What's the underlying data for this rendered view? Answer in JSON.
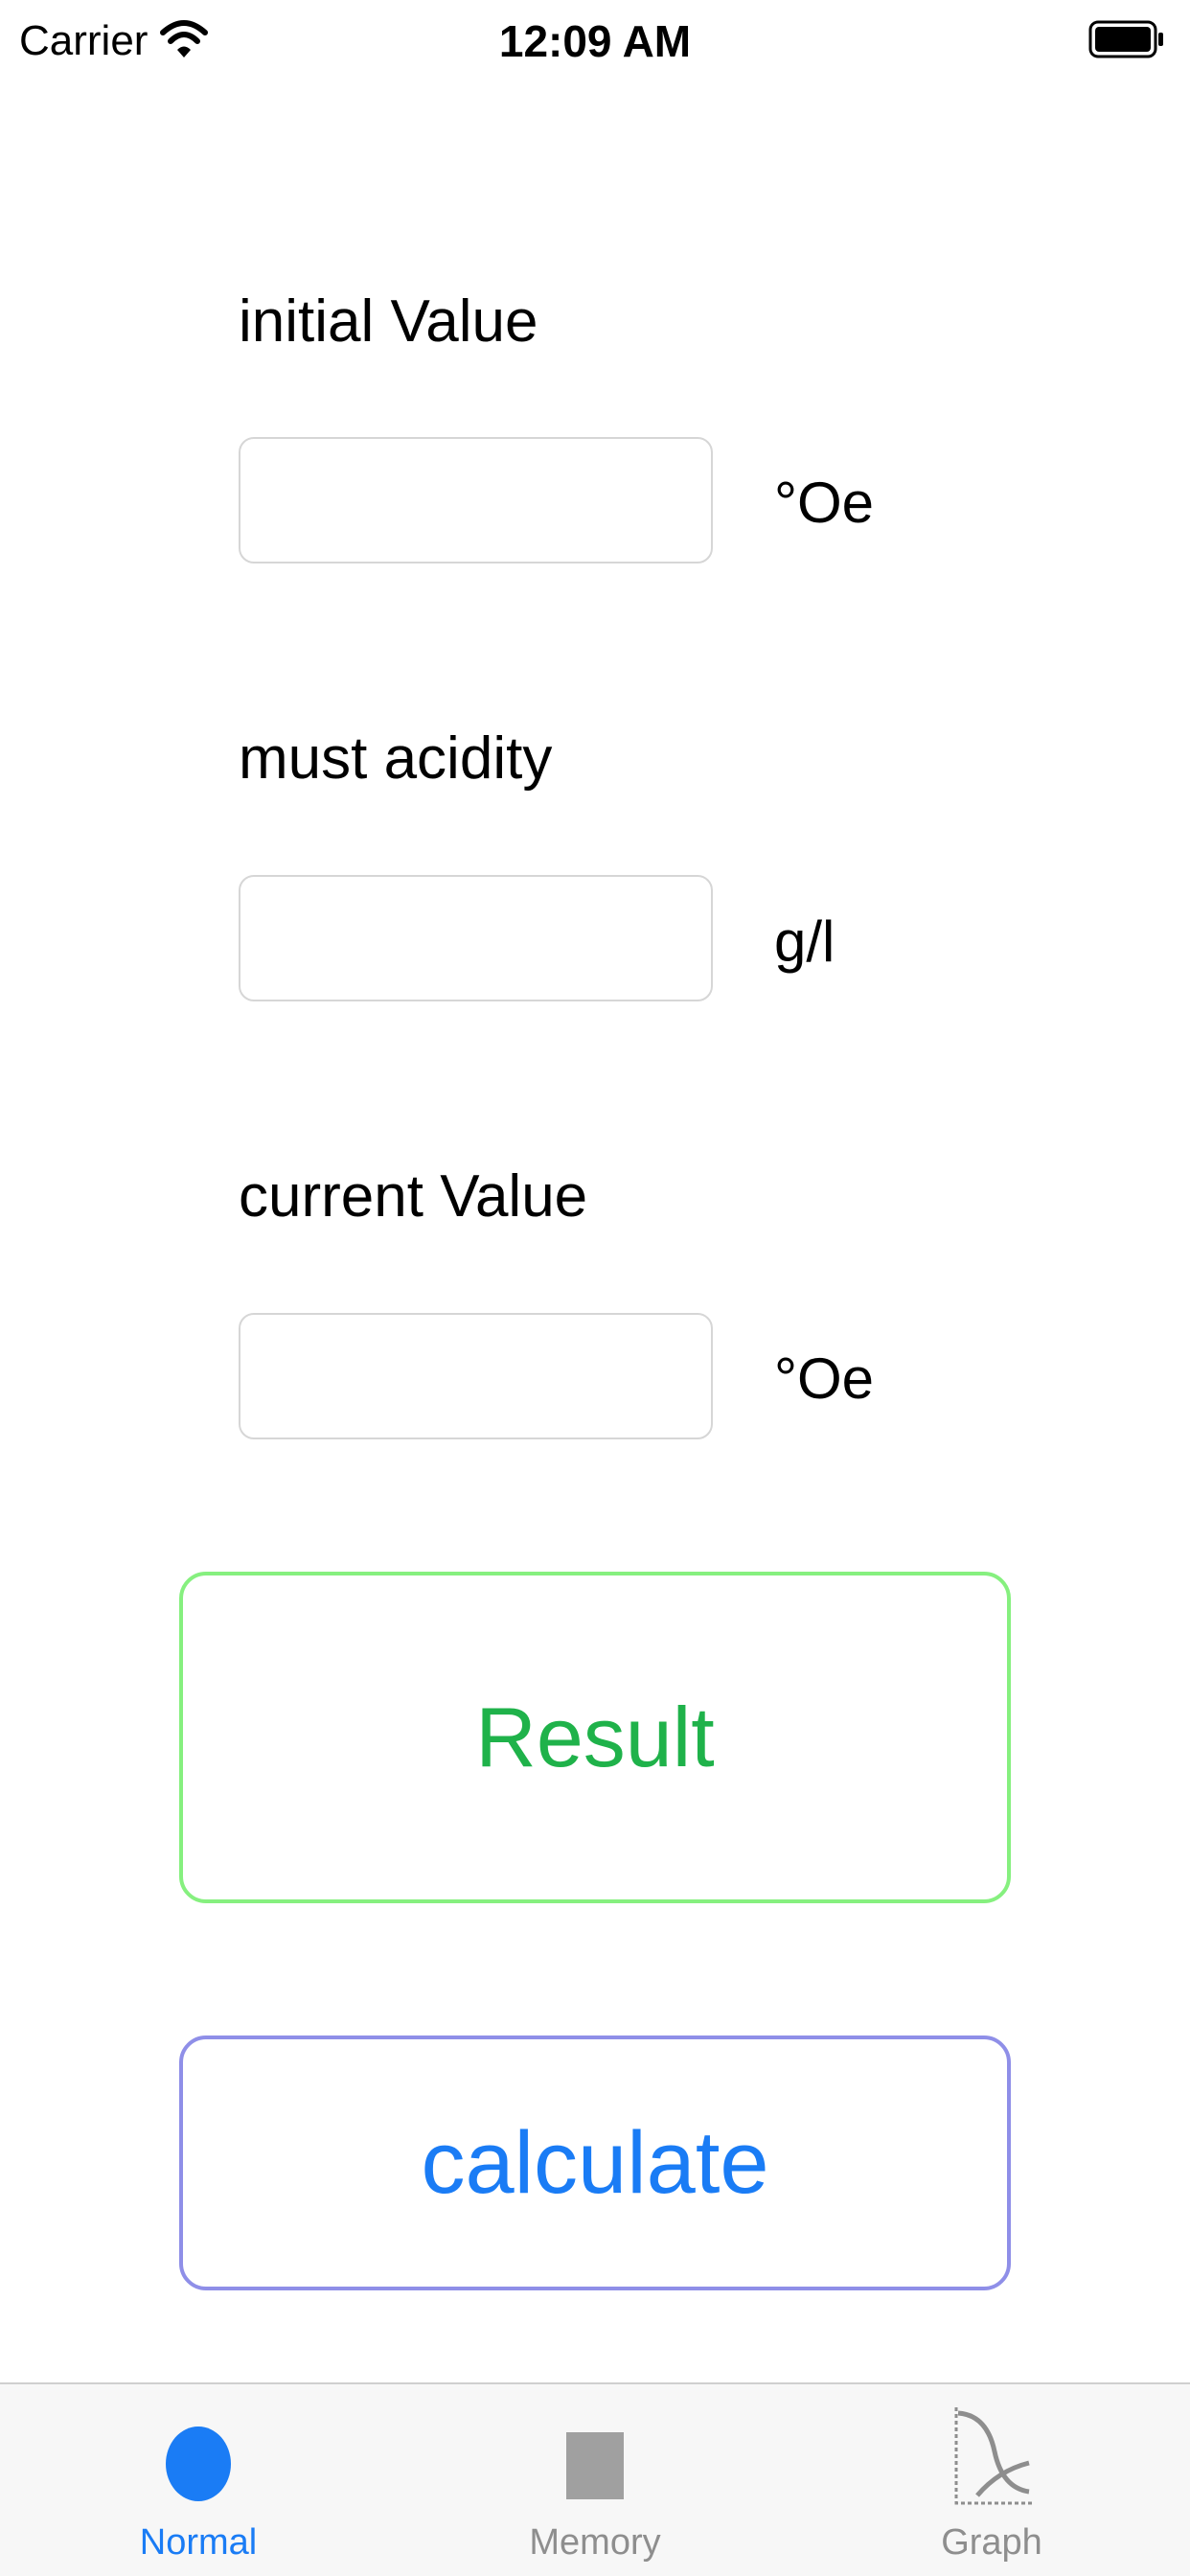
{
  "status_bar": {
    "carrier": "Carrier",
    "time": "12:09 AM",
    "icons": [
      "wifi-icon",
      "battery-icon"
    ]
  },
  "form": {
    "fields": [
      {
        "label": "initial Value",
        "value": "",
        "placeholder": "",
        "unit": "°Oe"
      },
      {
        "label": "must acidity",
        "value": "",
        "placeholder": "",
        "unit": "g/l"
      },
      {
        "label": "current Value",
        "value": "",
        "placeholder": "",
        "unit": "°Oe"
      }
    ]
  },
  "result": {
    "label": "Result",
    "color": "#1fb24a",
    "border_color": "#86f07f"
  },
  "calculate_button": {
    "label": "calculate",
    "color": "#1a7cf5",
    "border_color": "#8f8fe8"
  },
  "tab_bar": {
    "tabs": [
      {
        "label": "Normal",
        "icon": "circle-icon",
        "selected": true,
        "color": "#1a7cf5"
      },
      {
        "label": "Memory",
        "icon": "square-icon",
        "selected": false,
        "color": "#8e8e8e"
      },
      {
        "label": "Graph",
        "icon": "graph-icon",
        "selected": false,
        "color": "#8e8e8e"
      }
    ]
  }
}
